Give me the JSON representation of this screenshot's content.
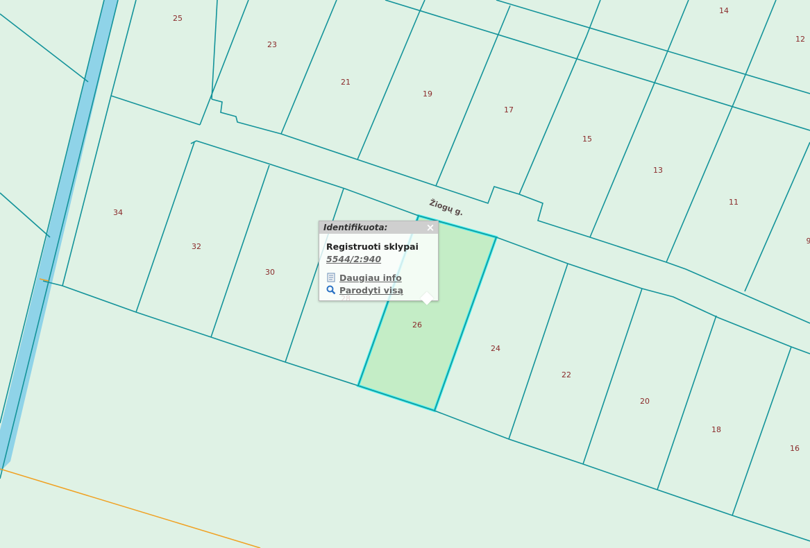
{
  "map": {
    "street_label": "Žiogų g.",
    "lot_numbers": {
      "n25": "25",
      "n23": "23",
      "n21": "21",
      "n19": "19",
      "n17": "17",
      "n15": "15",
      "n14": "14",
      "n13": "13",
      "n12": "12",
      "n11": "11",
      "n9": "9",
      "n34": "34",
      "n32": "32",
      "n30": "30",
      "n28": "28",
      "n26": "26",
      "n24": "24",
      "n22": "22",
      "n20": "20",
      "n18": "18",
      "n16": "16"
    },
    "colors": {
      "background": "#dff2e5",
      "parcel_line": "#13939a",
      "canal": "#8fd3e8",
      "boundary_orange": "#f0a020",
      "selected_fill": "#c4edc6",
      "selected_outline": "#42f0f0"
    }
  },
  "popup": {
    "title": "Identifikuota:",
    "close_glyph": "×",
    "layer_name": "Registruoti sklypai",
    "parcel_id": "5544/2:940",
    "more_info_label": "Daugiau info",
    "more_info_icon": "document-icon",
    "show_all_label": "Parodyti visą",
    "show_all_icon": "magnifier-icon"
  }
}
